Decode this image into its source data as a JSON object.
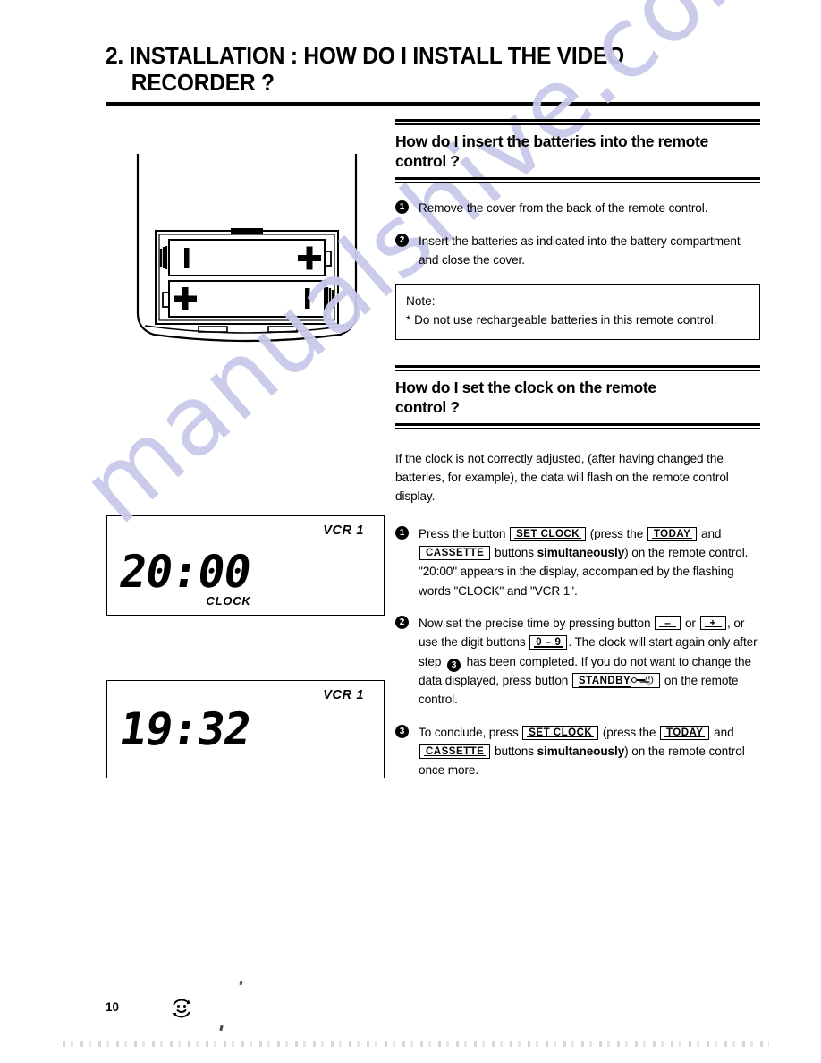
{
  "document": {
    "title_line_1": "2. INSTALLATION : HOW DO I INSTALL THE VIDEO",
    "title_line_2": "RECORDER ?",
    "page_number": "10",
    "watermark": "manualshive.com",
    "watermark_color": "#c9c9ea",
    "ink_color": "#000000",
    "paper_color": "#ffffff"
  },
  "sections": [
    {
      "id": "batteries",
      "heading": "How do I insert the batteries into the remote\ncontrol ?",
      "steps": [
        {
          "num": "1",
          "text": "Remove the cover from the back of the remote control."
        },
        {
          "num": "2",
          "text": "Insert the batteries as indicated into the battery compartment and close the cover."
        }
      ],
      "note": {
        "title": "Note:",
        "item": "* Do not use rechargeable batteries in this remote control."
      }
    },
    {
      "id": "clock",
      "heading": "How do I set the clock on the remote\ncontrol ?",
      "intro": "If the clock is not correctly adjusted, (after having changed the batteries, for example), the data will flash on the remote control display.",
      "steps": [
        {
          "num": "1",
          "parts": [
            {
              "t": "text",
              "v": "Press the button "
            },
            {
              "t": "key",
              "v": "SET  CLOCK"
            },
            {
              "t": "text",
              "v": " (press the "
            },
            {
              "t": "key",
              "v": "TODAY"
            },
            {
              "t": "text",
              "v": " and "
            },
            {
              "t": "key",
              "v": "CASSETTE"
            },
            {
              "t": "text",
              "v": " buttons "
            },
            {
              "t": "bold",
              "v": "simultaneously"
            },
            {
              "t": "text",
              "v": ") on the remote control. \"20:00\" appears in the display, accompanied by the flashing words \"CLOCK\" and \"VCR 1\"."
            }
          ]
        },
        {
          "num": "2",
          "parts": [
            {
              "t": "text",
              "v": "Now set the precise time by pressing button "
            },
            {
              "t": "key",
              "v": "–"
            },
            {
              "t": "text",
              "v": " or "
            },
            {
              "t": "key",
              "v": "+"
            },
            {
              "t": "text",
              "v": ", or use the digit buttons "
            },
            {
              "t": "key",
              "v": "0 – 9"
            },
            {
              "t": "text",
              "v": ". The clock will start again only after step "
            },
            {
              "t": "stepmark",
              "v": "3"
            },
            {
              "t": "text",
              "v": " has been completed. If you do not want to change the data displayed, press button "
            },
            {
              "t": "keystandby",
              "v": "STANDBY"
            },
            {
              "t": "text",
              "v": " on the remote control."
            }
          ]
        },
        {
          "num": "3",
          "parts": [
            {
              "t": "text",
              "v": "To conclude, press "
            },
            {
              "t": "key",
              "v": "SET  CLOCK"
            },
            {
              "t": "text",
              "v": " (press the "
            },
            {
              "t": "key",
              "v": "TODAY"
            },
            {
              "t": "text",
              "v": " and "
            },
            {
              "t": "key",
              "v": "CASSETTE"
            },
            {
              "t": "text",
              "v": " buttons "
            },
            {
              "t": "bold",
              "v": "simultaneously"
            },
            {
              "t": "text",
              "v": ") on the remote control once more."
            }
          ]
        }
      ]
    }
  ],
  "figures": {
    "remote": {
      "caption": "",
      "battery_top": {
        "left_terminal": "–",
        "right_terminal": "+"
      },
      "battery_bottom": {
        "left_terminal": "+",
        "right_terminal": "–"
      }
    },
    "lcd_1": {
      "time": "20:00",
      "vcr_label": "VCR 1",
      "mode_label": "CLOCK"
    },
    "lcd_2": {
      "time": "19:32",
      "vcr_label": "VCR 1",
      "mode_label": ""
    }
  },
  "footer": {
    "page_number": "10",
    "icon": "recycle-smiley-icon"
  }
}
